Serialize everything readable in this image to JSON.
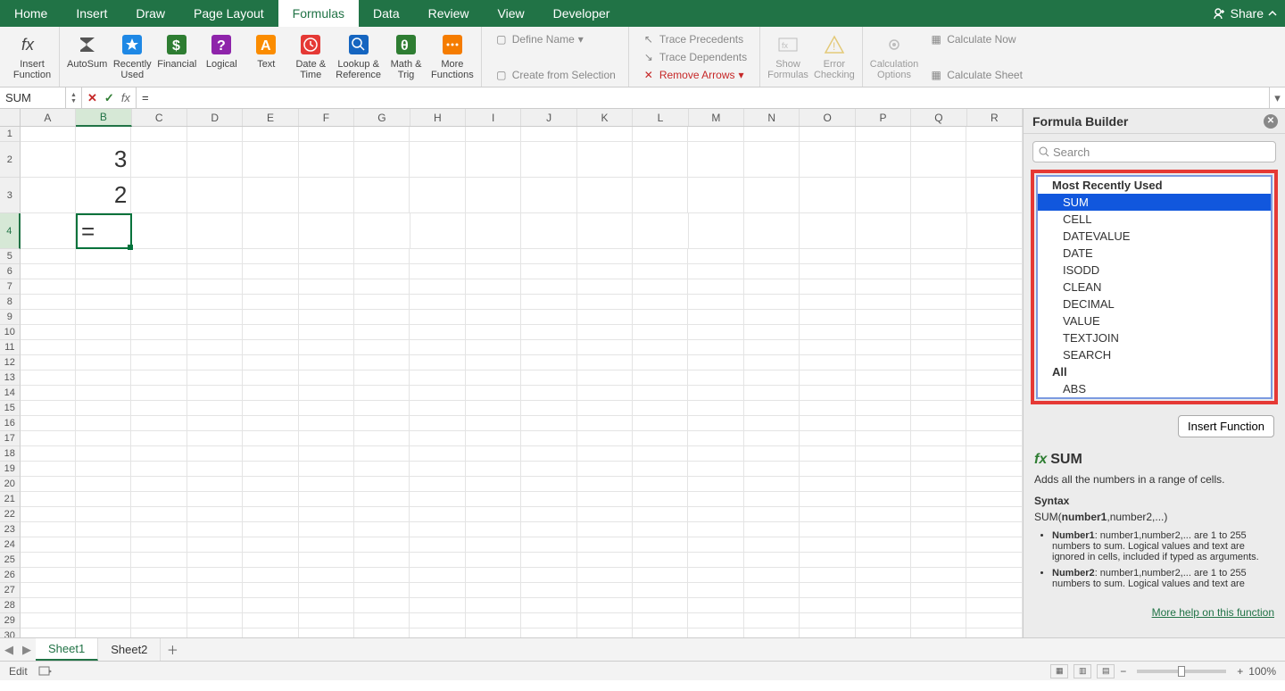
{
  "menu_tabs": [
    "Home",
    "Insert",
    "Draw",
    "Page Layout",
    "Formulas",
    "Data",
    "Review",
    "View",
    "Developer"
  ],
  "active_menu_tab": "Formulas",
  "share_label": "Share",
  "ribbon": {
    "insert_function": "Insert\nFunction",
    "autosum": "AutoSum",
    "recently_used": "Recently\nUsed",
    "financial": "Financial",
    "logical": "Logical",
    "text": "Text",
    "date_time": "Date &\nTime",
    "lookup_ref": "Lookup &\nReference",
    "math_trig": "Math &\nTrig",
    "more_functions": "More\nFunctions",
    "define_name": "Define Name",
    "create_from_selection": "Create from Selection",
    "trace_precedents": "Trace Precedents",
    "trace_dependents": "Trace Dependents",
    "remove_arrows": "Remove Arrows",
    "show_formulas": "Show\nFormulas",
    "error_checking": "Error\nChecking",
    "calculation_options": "Calculation\nOptions",
    "calculate_now": "Calculate Now",
    "calculate_sheet": "Calculate Sheet"
  },
  "name_box": "SUM",
  "formula_input": "=",
  "columns": [
    "A",
    "B",
    "C",
    "D",
    "E",
    "F",
    "G",
    "H",
    "I",
    "J",
    "K",
    "L",
    "M",
    "N",
    "O",
    "P",
    "Q",
    "R"
  ],
  "selected_col": "B",
  "selected_row": 4,
  "cells": {
    "B2": "3",
    "B3": "2",
    "B4": "="
  },
  "tall_rows": [
    2,
    3,
    4
  ],
  "row_count": 31,
  "panel": {
    "title": "Formula Builder",
    "search_placeholder": "Search",
    "group_recent": "Most Recently Used",
    "group_all": "All",
    "recent_functions": [
      "SUM",
      "CELL",
      "DATEVALUE",
      "DATE",
      "ISODD",
      "CLEAN",
      "DECIMAL",
      "VALUE",
      "TEXTJOIN",
      "SEARCH"
    ],
    "all_functions_preview": [
      "ABS"
    ],
    "selected_function": "SUM",
    "insert_function_label": "Insert Function",
    "fn_title": "SUM",
    "fn_desc": "Adds all the numbers in a range of cells.",
    "syntax_label": "Syntax",
    "syntax_text_prefix": "SUM(",
    "syntax_bold": "number1",
    "syntax_text_suffix": ",number2,...)",
    "args": [
      {
        "name": "Number1",
        "desc": ": number1,number2,... are 1 to 255 numbers to sum. Logical values and text are ignored in cells, included if typed as arguments."
      },
      {
        "name": "Number2",
        "desc": ": number1,number2,... are 1 to 255 numbers to sum. Logical values and text are"
      }
    ],
    "more_help": "More help on this function"
  },
  "sheet_tabs": [
    "Sheet1",
    "Sheet2"
  ],
  "active_sheet": "Sheet1",
  "status": {
    "mode": "Edit",
    "zoom": "100%"
  }
}
